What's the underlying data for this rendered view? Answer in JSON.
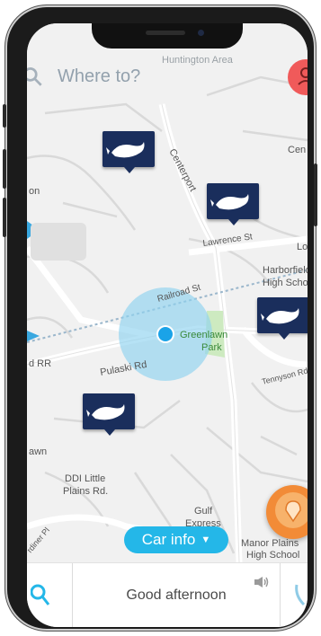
{
  "search": {
    "placeholder": "Where to?",
    "icon": "search-icon"
  },
  "map": {
    "street_labels": [
      "Huntington Area",
      "Centerport",
      "Lawrence St",
      "Railroad St",
      "Pulaski Rd",
      "Harborfields",
      "High School",
      "Greenlawn",
      "Park",
      "Tennyson Rd",
      "DDI Little",
      "Plains Rd.",
      "Gulf",
      "Express",
      "Manor Plains",
      "High School",
      "Cen",
      "Lo",
      "d RR",
      "awn",
      "rdiner Pl",
      "on"
    ],
    "colors": {
      "water_blue": "#3aa8e0",
      "park_green": "#cdeac0",
      "location_dot": "#1aa3e8",
      "marker_navy": "#1a2e5c"
    }
  },
  "car_info": {
    "label": "Car info"
  },
  "bottom_bar": {
    "greeting": "Good afternoon"
  }
}
